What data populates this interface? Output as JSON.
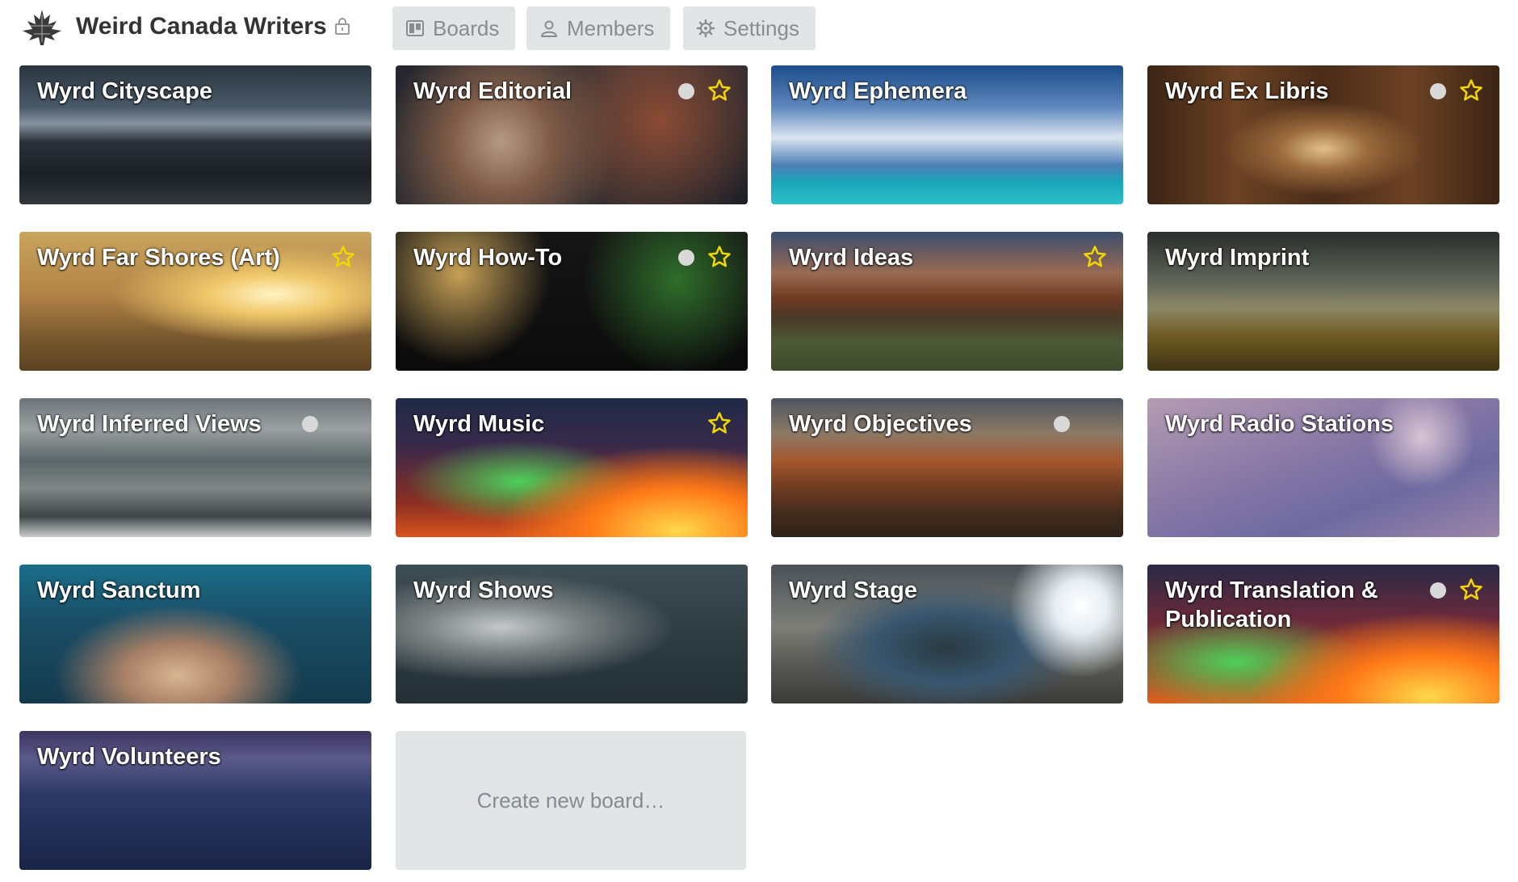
{
  "header": {
    "org_name": "Weird Canada Writers",
    "logo_icon": "maple-leaf-icon",
    "privacy_icon": "lock-icon",
    "nav": [
      {
        "label": "Boards",
        "icon": "board-icon"
      },
      {
        "label": "Members",
        "icon": "person-icon"
      },
      {
        "label": "Settings",
        "icon": "gear-icon"
      }
    ]
  },
  "boards": [
    {
      "title": "Wyrd Cityscape",
      "dot": false,
      "starred": false
    },
    {
      "title": "Wyrd Editorial",
      "dot": true,
      "starred": true
    },
    {
      "title": "Wyrd Ephemera",
      "dot": false,
      "starred": false
    },
    {
      "title": "Wyrd Ex Libris",
      "dot": true,
      "starred": true
    },
    {
      "title": "Wyrd Far Shores (Art)",
      "dot": false,
      "starred": true
    },
    {
      "title": "Wyrd How-To",
      "dot": true,
      "starred": true
    },
    {
      "title": "Wyrd Ideas",
      "dot": false,
      "starred": true
    },
    {
      "title": "Wyrd Imprint",
      "dot": false,
      "starred": false
    },
    {
      "title": "Wyrd Inferred Views",
      "dot": true,
      "starred": false
    },
    {
      "title": "Wyrd Music",
      "dot": false,
      "starred": true
    },
    {
      "title": "Wyrd Objectives",
      "dot": true,
      "starred": false
    },
    {
      "title": "Wyrd Radio Stations",
      "dot": false,
      "starred": false
    },
    {
      "title": "Wyrd Sanctum",
      "dot": false,
      "starred": false
    },
    {
      "title": "Wyrd Shows",
      "dot": false,
      "starred": false
    },
    {
      "title": "Wyrd Stage",
      "dot": false,
      "starred": false
    },
    {
      "title": "Wyrd Translation & Publication",
      "dot": true,
      "starred": true
    },
    {
      "title": "Wyrd Volunteers",
      "dot": false,
      "starred": false
    }
  ],
  "create_board_label": "Create new board…",
  "colors": {
    "star": "#f2d600",
    "nav_bg": "#e2e4e6",
    "nav_text": "#8c8c8c",
    "title_text": "#333333"
  }
}
